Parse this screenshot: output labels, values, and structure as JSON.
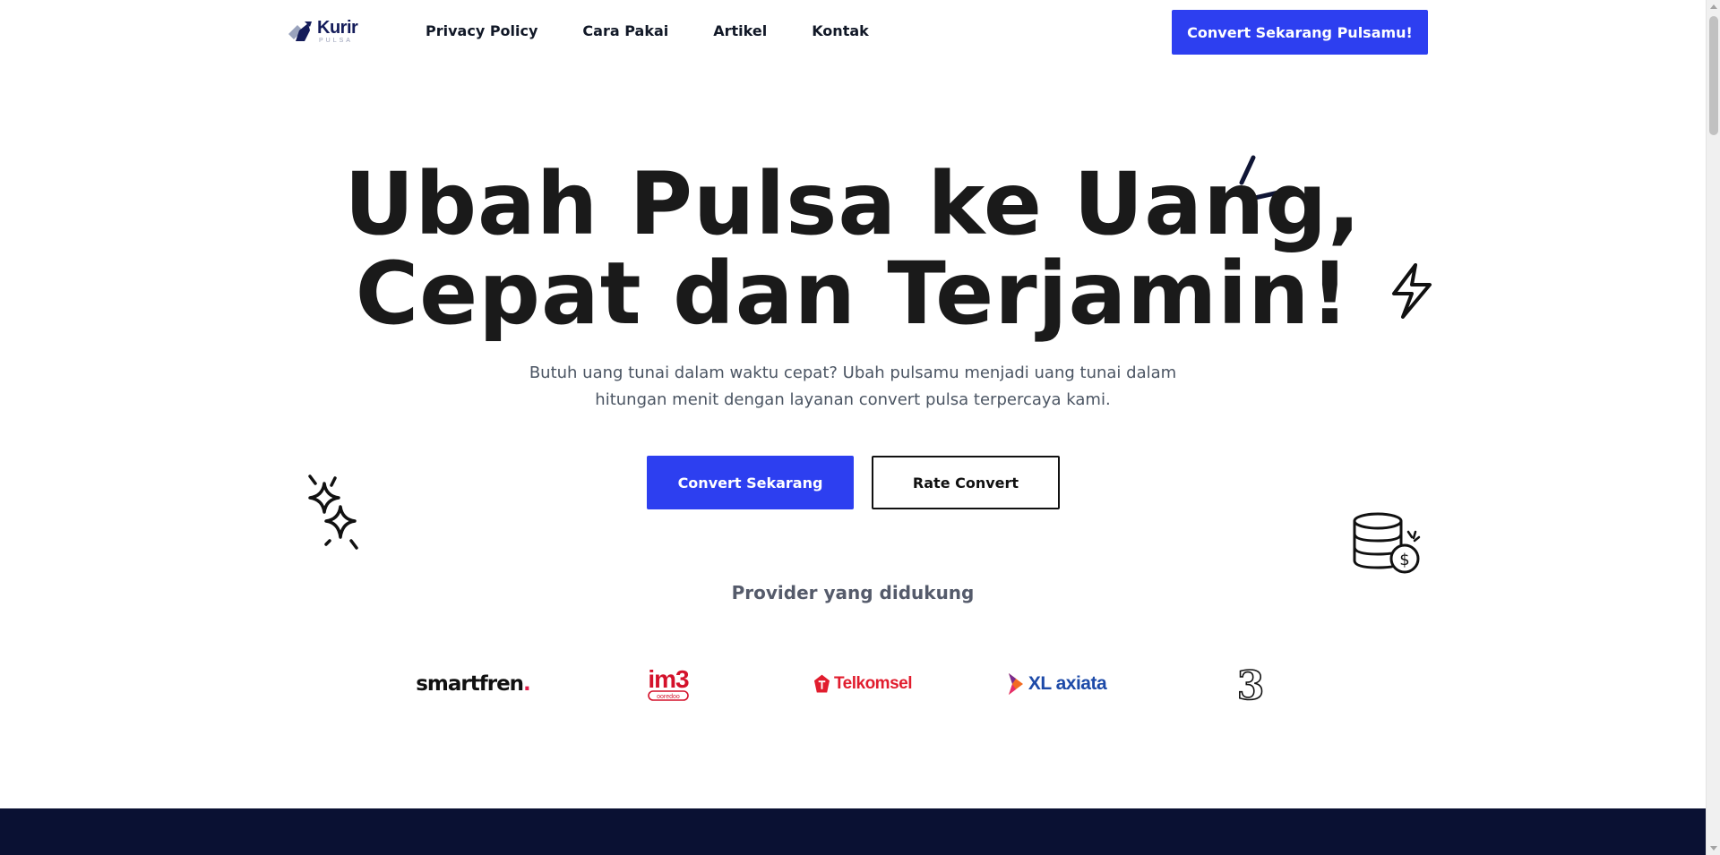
{
  "header": {
    "logo_text": "Kurir",
    "logo_subtext": "PULSA",
    "nav": [
      {
        "label": "Privacy Policy"
      },
      {
        "label": "Cara Pakai"
      },
      {
        "label": "Artikel"
      },
      {
        "label": "Kontak"
      }
    ],
    "cta_label": "Convert Sekarang Pulsamu!"
  },
  "hero": {
    "title_line1": "Ubah Pulsa ke Uang,",
    "title_line2": "Cepat dan Terjamin!",
    "subtitle": "Butuh uang tunai dalam waktu cepat? Ubah pulsamu menjadi uang tunai dalam hitungan menit dengan layanan convert pulsa terpercaya kami.",
    "primary_button": "Convert Sekarang",
    "secondary_button": "Rate Convert"
  },
  "providers": {
    "title": "Provider yang didukung",
    "items": [
      {
        "name": "smartfren",
        "logo_text": "smartfren",
        "logo_dot": "."
      },
      {
        "name": "im3",
        "logo_text": "im3",
        "logo_subtext": "ooredoo"
      },
      {
        "name": "telkomsel",
        "logo_text": "Telkomsel"
      },
      {
        "name": "xl-axiata",
        "logo_text": "XL axiata"
      },
      {
        "name": "three",
        "logo_text": "3"
      }
    ]
  },
  "colors": {
    "primary": "#2d3ff0",
    "navy": "#0a1133",
    "text_dark": "#1a1a1a",
    "text_muted": "#4b5563"
  },
  "icons": [
    "kurir-logo-icon",
    "accent-strokes-icon",
    "lightning-icon",
    "sparkles-icon",
    "coins-dollar-icon"
  ]
}
